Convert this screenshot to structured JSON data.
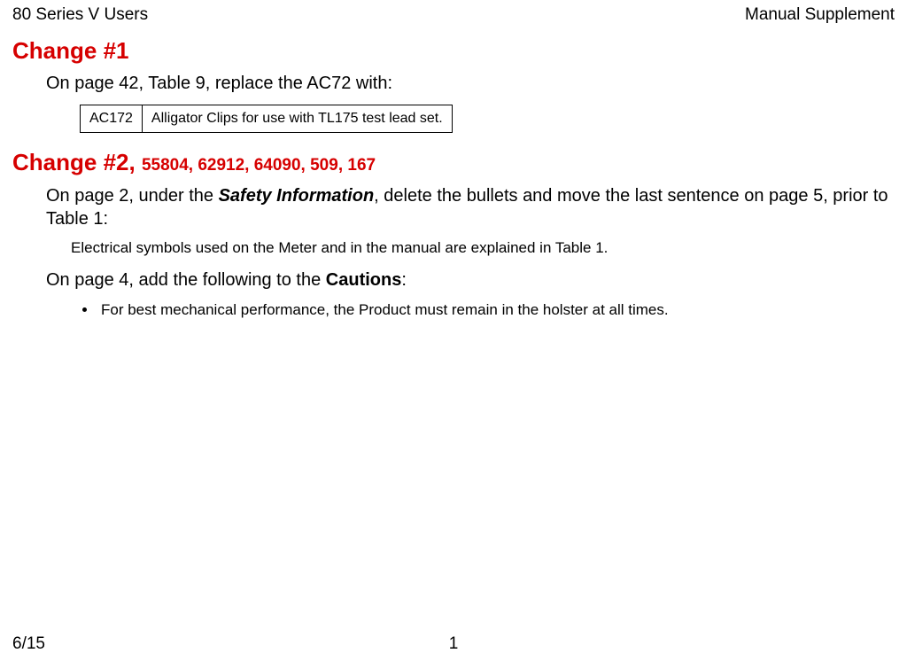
{
  "header": {
    "left": "80 Series V Users",
    "right": "Manual Supplement"
  },
  "change1": {
    "title": "Change #1",
    "intro": "On page 42, Table 9, replace the AC72 with:",
    "table": {
      "code": "AC172",
      "desc": "Alligator Clips for use with TL175 test lead set."
    }
  },
  "change2": {
    "title_main": "Change #2, ",
    "title_codes": "55804, 62912, 64090, 509, 167",
    "para1_pre": "On page 2, under the ",
    "para1_em": "Safety Information",
    "para1_post": ", delete the bullets and move the last sentence on page 5, prior to Table 1:",
    "subtext": "Electrical symbols used on the Meter and in the manual are explained in Table 1.",
    "para2_pre": "On page 4, add the following to the ",
    "para2_b": "Cautions",
    "para2_post": ":",
    "bullets": [
      "For best mechanical performance, the Product must remain in the holster at all times."
    ]
  },
  "footer": {
    "left": "6/15",
    "center": "1"
  }
}
